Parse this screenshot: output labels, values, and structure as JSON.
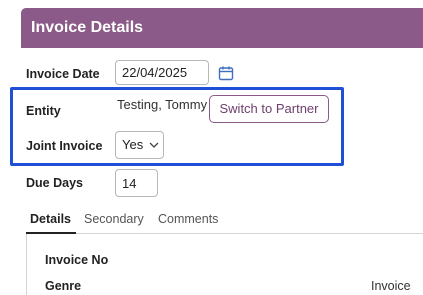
{
  "panel": {
    "title": "Invoice Details"
  },
  "form": {
    "invoice_date": {
      "label": "Invoice Date",
      "value": "22/04/2025"
    },
    "entity": {
      "label": "Entity",
      "value": "Testing, Tommy",
      "switch_button": "Switch to Partner"
    },
    "joint_invoice": {
      "label": "Joint Invoice",
      "value": "Yes"
    },
    "due_days": {
      "label": "Due Days",
      "value": "14"
    }
  },
  "tabs": [
    {
      "label": "Details",
      "active": true
    },
    {
      "label": "Secondary",
      "active": false
    },
    {
      "label": "Comments",
      "active": false
    }
  ],
  "details": {
    "invoice_no_label": "Invoice No",
    "genre_label": "Genre",
    "genre_value": "Invoice"
  },
  "colors": {
    "header": "#8b5a88",
    "highlight": "#1f4fd6",
    "accent": "#6e3f6c"
  }
}
